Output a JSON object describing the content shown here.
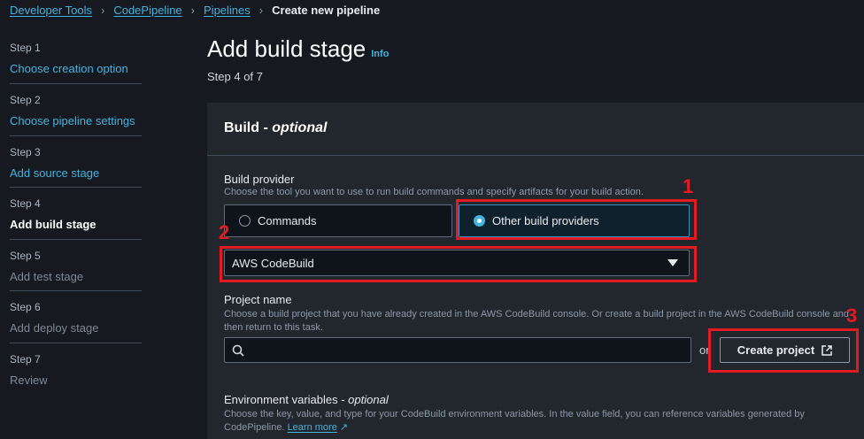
{
  "breadcrumb": [
    "Developer Tools",
    "CodePipeline",
    "Pipelines",
    "Create new pipeline"
  ],
  "steps": [
    {
      "step": "Step 1",
      "label": "Choose creation option"
    },
    {
      "step": "Step 2",
      "label": "Choose pipeline settings"
    },
    {
      "step": "Step 3",
      "label": "Add source stage"
    },
    {
      "step": "Step 4",
      "label": "Add build stage"
    },
    {
      "step": "Step 5",
      "label": "Add test stage"
    },
    {
      "step": "Step 6",
      "label": "Add deploy stage"
    },
    {
      "step": "Step 7",
      "label": "Review"
    }
  ],
  "page": {
    "title": "Add build stage",
    "info": "Info",
    "subtitle": "Step 4 of 7"
  },
  "panel": {
    "title": "Build - ",
    "title_optional": "optional",
    "build_provider": {
      "label": "Build provider",
      "desc": "Choose the tool you want to use to run build commands and specify artifacts for your build action.",
      "options": [
        "Commands",
        "Other build providers"
      ],
      "selected": "Other build providers"
    },
    "provider_select": {
      "value": "AWS CodeBuild"
    },
    "project_name": {
      "label": "Project name",
      "desc": "Choose a build project that you have already created in the AWS CodeBuild console. Or create a build project in the AWS CodeBuild console and then return to this task.",
      "placeholder": "",
      "or": "or",
      "create_button": "Create project"
    },
    "env_vars": {
      "label": "Environment variables - ",
      "label_optional": "optional",
      "desc": "Choose the key, value, and type for your CodeBuild environment variables. In the value field, you can reference variables generated by CodePipeline.",
      "learn_more": "Learn more"
    }
  },
  "annotations": [
    "1",
    "2",
    "3"
  ]
}
